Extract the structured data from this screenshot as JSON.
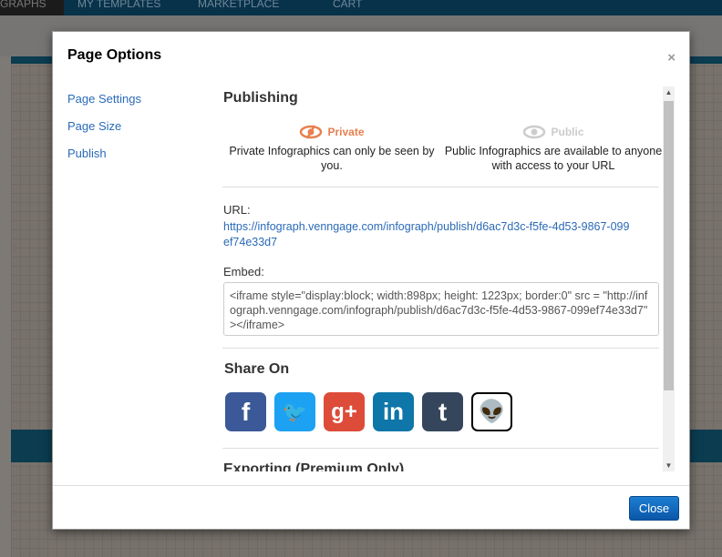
{
  "topnav": {
    "items": [
      "GRAPHS",
      "MY TEMPLATES",
      "MARKETPLACE",
      "CART"
    ]
  },
  "modal": {
    "title": "Page Options",
    "close_x": "×",
    "sidebar": [
      "Page Settings",
      "Page Size",
      "Publish"
    ],
    "publishing": {
      "heading": "Publishing",
      "private": {
        "label": "Private",
        "desc": "Private Infographics can only be seen by you.",
        "color": "#e8804f",
        "selected": true
      },
      "public": {
        "label": "Public",
        "desc": "Public Infographics are available to anyone with access to your URL",
        "color": "#cccccc"
      },
      "url_label": "URL:",
      "url": "https://infograph.venngage.com/infograph/publish/d6ac7d3c-f5fe-4d53-9867-099ef74e33d7",
      "embed_label": "Embed:",
      "embed": "<iframe style=\"display:block; width:898px; height: 1223px; border:0\" src = \"http://infograph.venngage.com/infograph/publish/d6ac7d3c-f5fe-4d53-9867-099ef74e33d7\" ></iframe>"
    },
    "share": {
      "heading": "Share On",
      "networks": [
        {
          "name": "Facebook",
          "glyph": "f",
          "color": "#3b5998"
        },
        {
          "name": "Twitter",
          "glyph": "🐦",
          "color": "#1da1f2"
        },
        {
          "name": "Google+",
          "glyph": "g+",
          "color": "#dd4b39"
        },
        {
          "name": "LinkedIn",
          "glyph": "in",
          "color": "#0e76a8"
        },
        {
          "name": "Tumblr",
          "glyph": "t",
          "color": "#35465c"
        },
        {
          "name": "Reddit",
          "glyph": "👽",
          "color": "#ffffff"
        }
      ]
    },
    "exporting_heading": "Exporting (Premium Only)",
    "close_button": "Close"
  }
}
